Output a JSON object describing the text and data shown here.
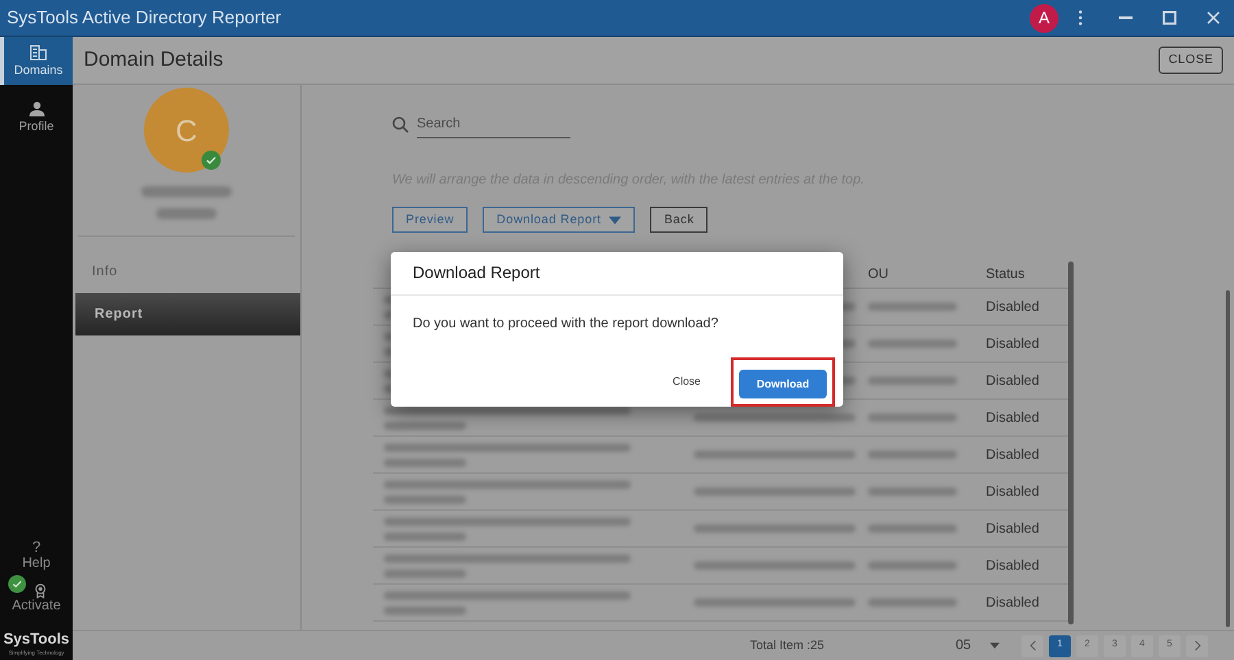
{
  "window": {
    "title": "SysTools Active Directory Reporter",
    "avatar_letter": "A"
  },
  "nav": [
    {
      "label": "Domains",
      "kind": "domains",
      "selected": true
    },
    {
      "label": "Profile",
      "kind": "profile",
      "selected": false
    }
  ],
  "help": {
    "icon": "?",
    "label": "Help"
  },
  "activate": {
    "label": "Activate",
    "activated": true
  },
  "logo": {
    "name": "SysTools",
    "tagline": "Simplifying Technology"
  },
  "page": {
    "title": "Domain Details",
    "close": "CLOSE"
  },
  "profile": {
    "initial": "C",
    "verified": true
  },
  "tabs": [
    {
      "label": "Info",
      "selected": false
    },
    {
      "label": "Report",
      "selected": true
    }
  ],
  "search": {
    "placeholder": "Search"
  },
  "hint": "We will arrange the data in descending order, with the latest entries at the top.",
  "actions": [
    {
      "label": "Preview",
      "kind": "outline"
    },
    {
      "label": "Download Report",
      "kind": "dropdown"
    },
    {
      "label": "Back",
      "kind": "plain"
    }
  ],
  "table": {
    "columns": [
      "OU",
      "Status"
    ],
    "rows": [
      {
        "status": "Disabled"
      },
      {
        "status": "Disabled"
      },
      {
        "status": "Disabled"
      },
      {
        "status": "Disabled"
      },
      {
        "status": "Disabled"
      },
      {
        "status": "Disabled"
      },
      {
        "status": "Disabled"
      },
      {
        "status": "Disabled"
      },
      {
        "status": "Disabled"
      }
    ]
  },
  "pagination": {
    "total": "Total Item :25",
    "page_size": "05",
    "pages": [
      {
        "label": "1",
        "selected": true
      },
      {
        "label": "2",
        "selected": false
      },
      {
        "label": "3",
        "selected": false
      },
      {
        "label": "4",
        "selected": false
      },
      {
        "label": "5",
        "selected": false
      }
    ]
  },
  "dialog": {
    "title": "Download Report",
    "message": "Do you want to proceed with the report download?",
    "buttons": [
      {
        "label": "Close",
        "kind": "text",
        "highlighted": false
      },
      {
        "label": "Download",
        "kind": "primary",
        "highlighted": true
      }
    ]
  }
}
